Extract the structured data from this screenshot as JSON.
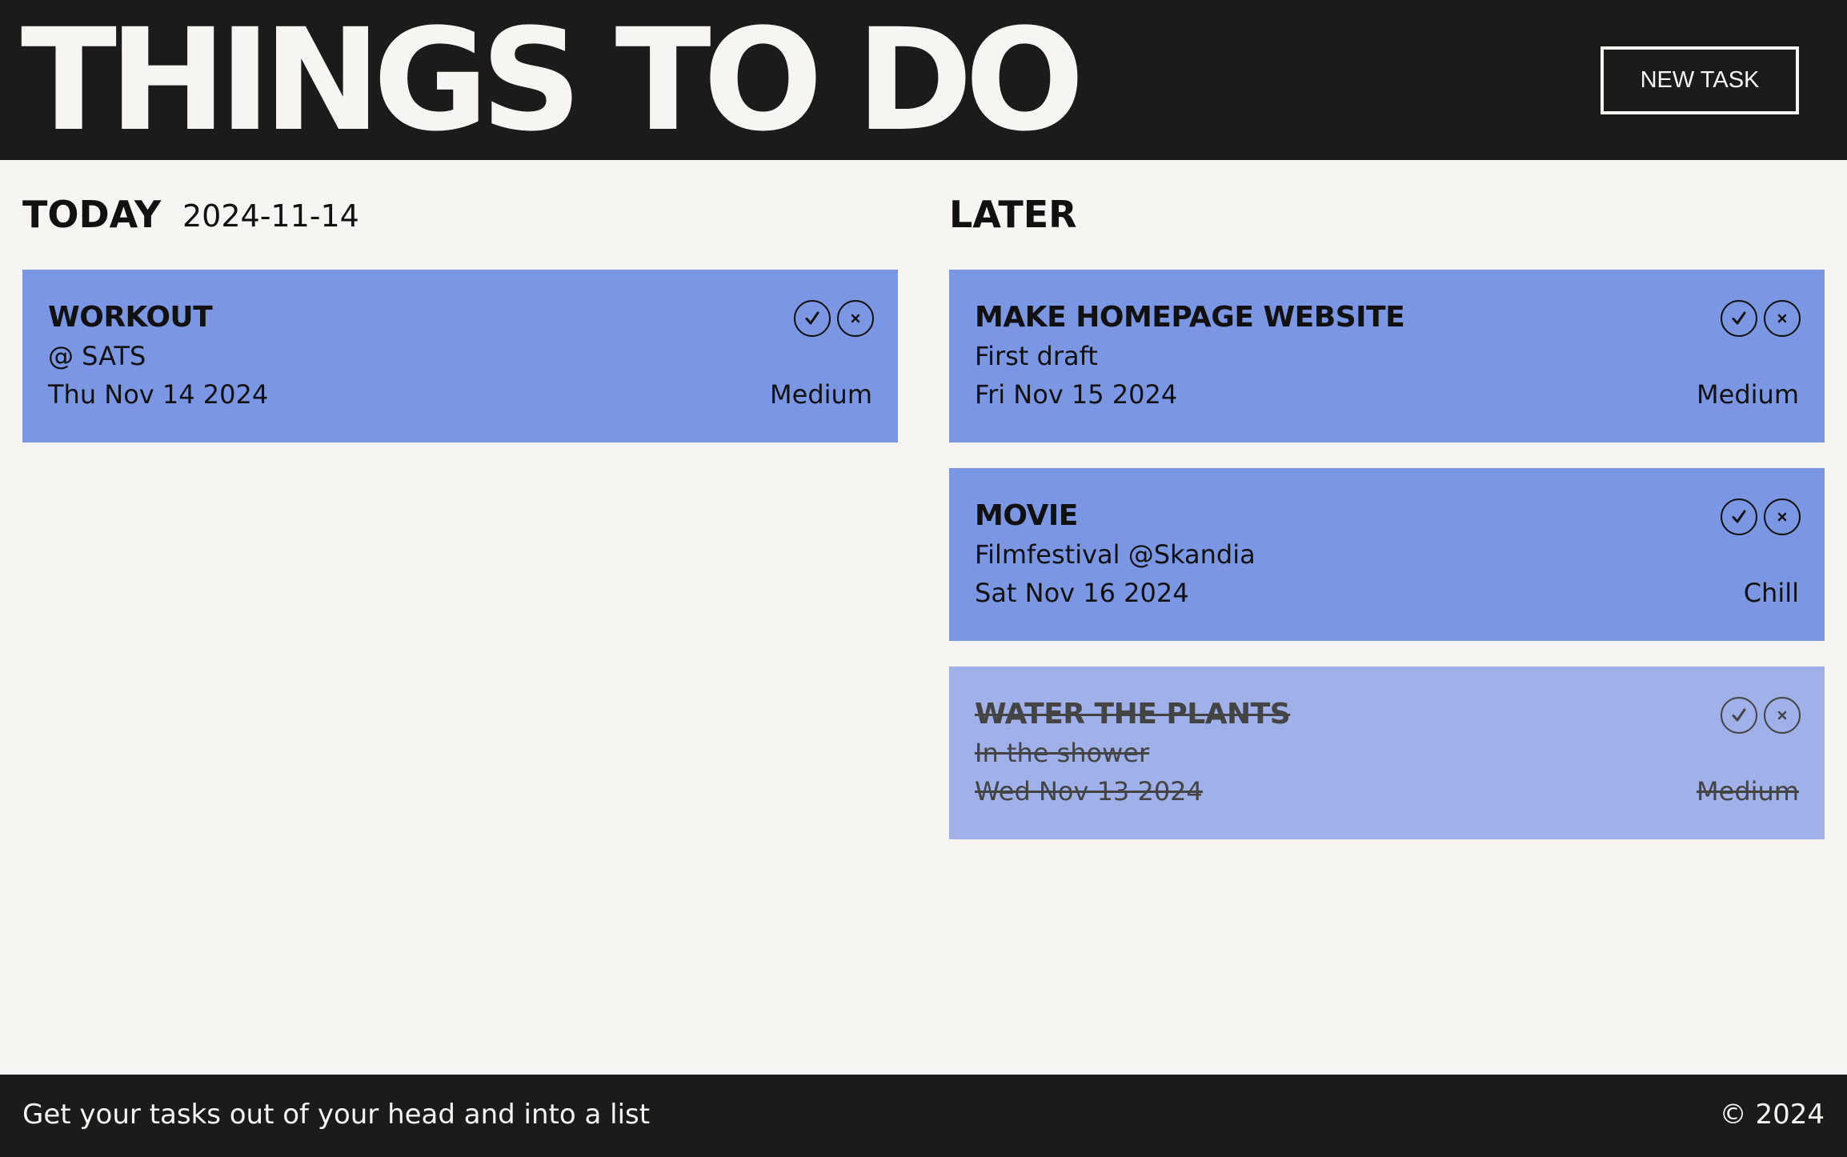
{
  "header": {
    "title": "THINGS TO DO",
    "new_task_label": "NEW TASK"
  },
  "today": {
    "heading": "TODAY",
    "date": "2024-11-14",
    "tasks": [
      {
        "title": "WORKOUT",
        "description": "@ SATS",
        "date": "Thu Nov 14 2024",
        "priority": "Medium",
        "done": false
      }
    ]
  },
  "later": {
    "heading": "LATER",
    "tasks": [
      {
        "title": "MAKE HOMEPAGE WEBSITE",
        "description": "First draft",
        "date": "Fri Nov 15 2024",
        "priority": "Medium",
        "done": false
      },
      {
        "title": "MOVIE",
        "description": "Filmfestival @Skandia",
        "date": "Sat Nov 16 2024",
        "priority": "Chill",
        "done": false
      },
      {
        "title": "WATER THE PLANTS",
        "description": "In the shower",
        "date": "Wed Nov 13 2024",
        "priority": "Medium",
        "done": true
      }
    ]
  },
  "footer": {
    "tagline": "Get your tasks out of your head and into a list",
    "copyright": "© 2024"
  },
  "colors": {
    "dark": "#1b1b1b",
    "background": "#f6f5f2",
    "card": "#7b97e3",
    "card_done": "#9fb1e8"
  },
  "icons": {
    "complete": "check-icon",
    "delete": "close-icon"
  }
}
